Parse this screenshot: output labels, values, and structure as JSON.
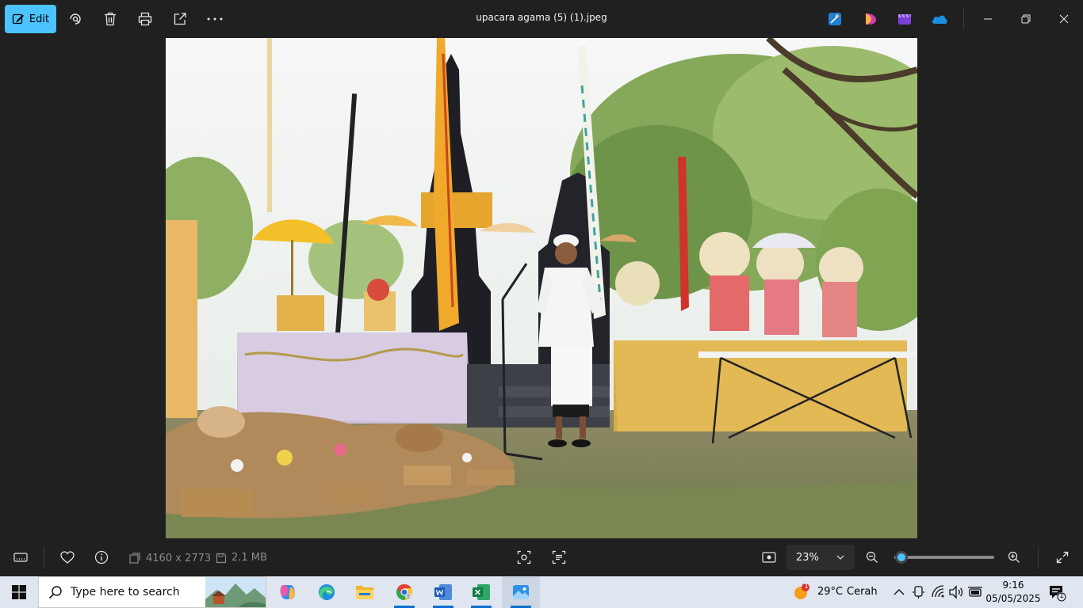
{
  "toolbar": {
    "edit_label": "Edit",
    "file_title": "upacara agama (5) (1).jpeg"
  },
  "info": {
    "dimensions": "4160 x 2773",
    "file_size": "2.1 MB"
  },
  "zoom": {
    "value_label": "23%",
    "slider_level": 0.07
  },
  "taskbar": {
    "search_placeholder": "Type here to search",
    "weather_badge": "1",
    "temperature": "29°C",
    "weather_desc": "Cerah",
    "time": "9:16",
    "date": "05/05/2025",
    "notification_count": "1"
  },
  "colors": {
    "accent": "#4cc2ff",
    "background": "#202020",
    "taskbar": "#dfe6f0"
  }
}
